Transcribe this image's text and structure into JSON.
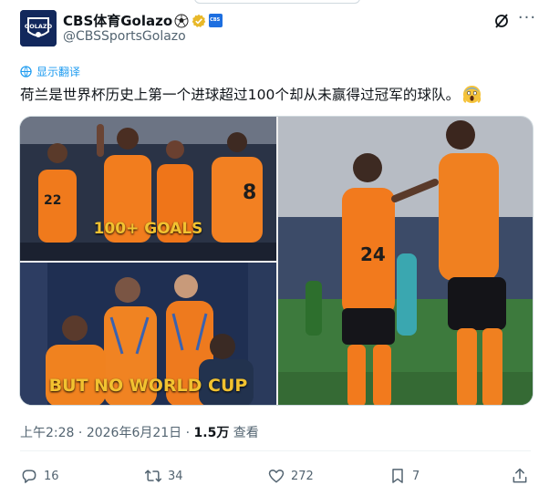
{
  "author": {
    "display_name": "CBS体育Golazo",
    "handle": "@CBSSportsGolazo",
    "avatar_label": "GOLAZO"
  },
  "header_icons": [
    "grok-icon",
    "more-icon"
  ],
  "translate_label": "显示翻译",
  "tweet_text": "荷兰是世界杯历史上第一个进球超过100个却从未赢得过冠军的球队。",
  "media": {
    "caption_top": "100+ GOALS",
    "caption_bottom": "BUT NO WORLD CUP"
  },
  "meta": {
    "time": "上午2:28",
    "sep": " · ",
    "date": "2026年6月21日",
    "sep2": " · ",
    "views": "1.5万",
    "views_label": " 查看"
  },
  "actions": {
    "replies": "16",
    "reposts": "34",
    "likes": "272",
    "bookmarks": "7"
  },
  "colors": {
    "accent": "#1d9bf0",
    "caption": "#f2c230",
    "verified": "#e8b829"
  }
}
